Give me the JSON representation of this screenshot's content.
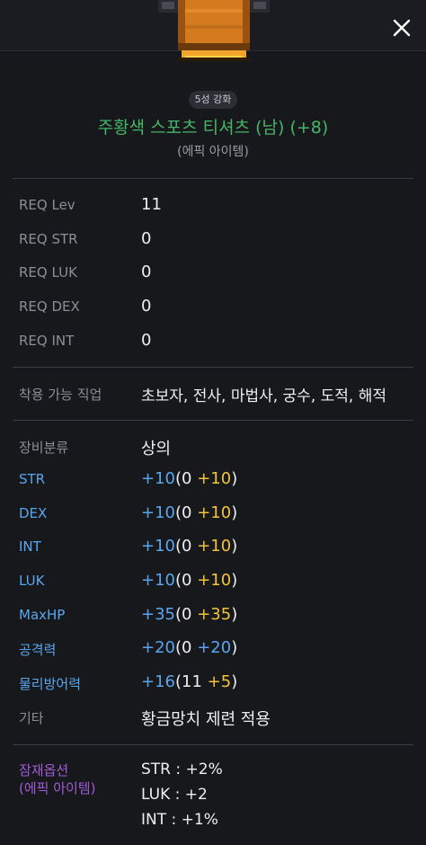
{
  "item": {
    "badge": "5성 강화",
    "name": "주황색 스포츠 티셔츠 (남) (+8)",
    "grade": "(에픽 아이템)"
  },
  "requirements": [
    {
      "label": "REQ Lev",
      "value": "11"
    },
    {
      "label": "REQ STR",
      "value": "0"
    },
    {
      "label": "REQ LUK",
      "value": "0"
    },
    {
      "label": "REQ DEX",
      "value": "0"
    },
    {
      "label": "REQ INT",
      "value": "0"
    }
  ],
  "jobs": {
    "label": "착용 가능 직업",
    "value": "초보자, 전사, 마법사, 궁수, 도적, 해적"
  },
  "category": {
    "label": "장비분류",
    "value": "상의"
  },
  "stats": [
    {
      "label": "STR",
      "total": "+10",
      "base": "0",
      "bonus": "+10"
    },
    {
      "label": "DEX",
      "total": "+10",
      "base": "0",
      "bonus": "+10"
    },
    {
      "label": "INT",
      "total": "+10",
      "base": "0",
      "bonus": "+10"
    },
    {
      "label": "LUK",
      "total": "+10",
      "base": "0",
      "bonus": "+10"
    },
    {
      "label": "MaxHP",
      "total": "+35",
      "base": "0",
      "bonus": "+35"
    },
    {
      "label": "공격력",
      "total": "+20",
      "base": "0",
      "bonus": "+20"
    },
    {
      "label": "물리방어력",
      "total": "+16",
      "base": "11",
      "bonus": "+5"
    }
  ],
  "etc": {
    "label": "기타",
    "value": "황금망치 제련 적용"
  },
  "potential": {
    "label_line1": "잠재옵션",
    "label_line2": "(에픽 아이템)",
    "options": [
      "STR : +2%",
      "LUK : +2",
      "INT : +1%"
    ]
  },
  "colors": {
    "name": "#46b467",
    "stat_blue": "#5aa6ee",
    "bonus_gold": "#f3c33b",
    "potential_purple": "#a05cd6"
  },
  "icons": {
    "close": "close-icon",
    "item": "orange-shirt-item-icon"
  }
}
